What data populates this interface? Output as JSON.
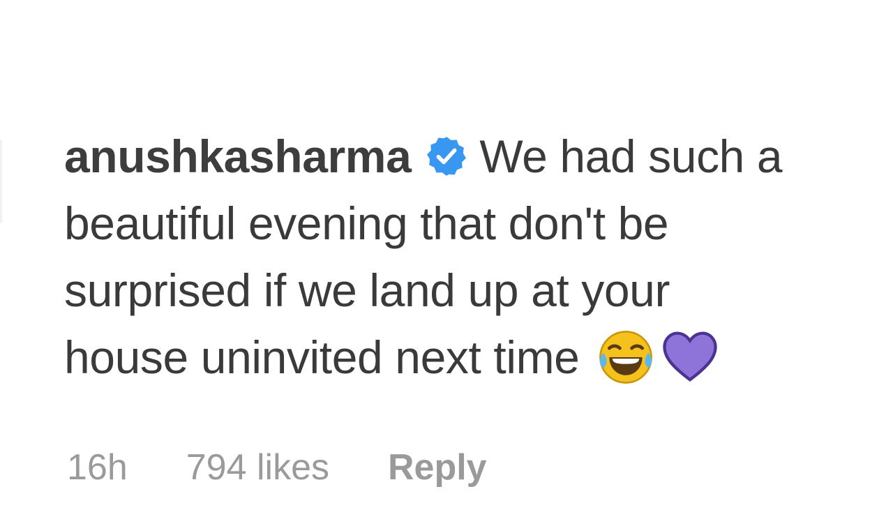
{
  "comment": {
    "username": "anushkasharma",
    "verified_icon": "verified-badge-icon",
    "text_line1": "We had such a",
    "text_line2": "beautiful evening that don't be",
    "text_line3": "surprised if we land up at your",
    "text_line4": "house uninvited next time",
    "emojis": [
      "laughing-tears-emoji",
      "purple-heart-emoji"
    ]
  },
  "meta": {
    "time": "16h",
    "likes": "794 likes",
    "reply_label": "Reply"
  },
  "colors": {
    "verified_blue": "#3897f0",
    "heart_purple": "#8e73d9",
    "meta_gray": "#9a9a9a",
    "text_dark": "#3a3a3a"
  }
}
